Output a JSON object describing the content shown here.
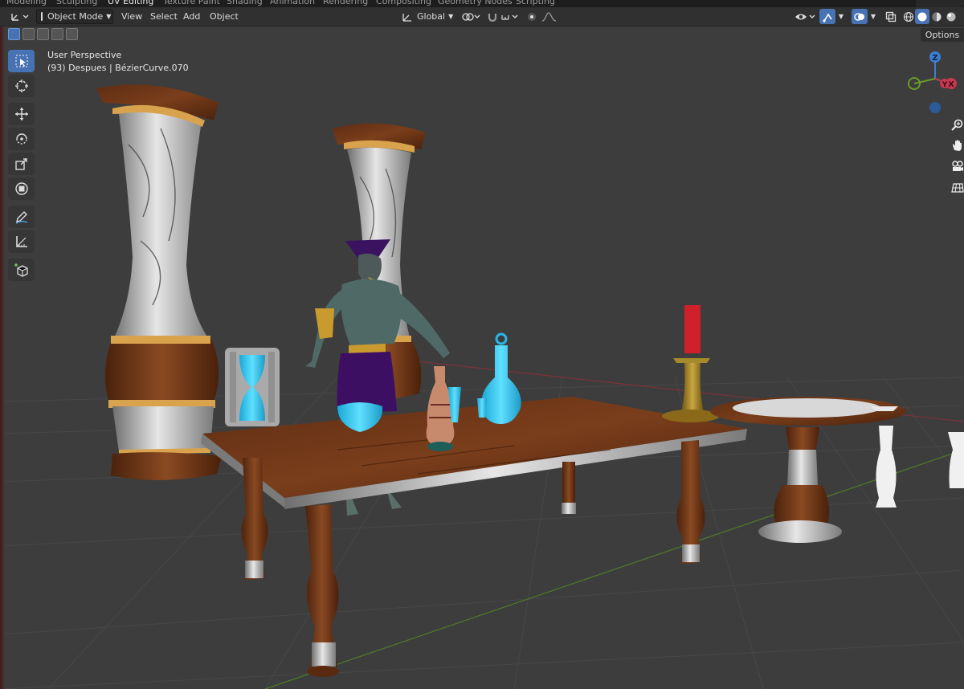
{
  "workspace_tabs": [
    {
      "label": "Modeling",
      "active": false
    },
    {
      "label": "Sculpting",
      "active": false
    },
    {
      "label": "UV Editing",
      "active": true
    },
    {
      "label": "Texture Paint",
      "active": false
    },
    {
      "label": "Shading",
      "active": false
    },
    {
      "label": "Animation",
      "active": false
    },
    {
      "label": "Rendering",
      "active": false
    },
    {
      "label": "Compositing",
      "active": false
    },
    {
      "label": "Geometry Nodes",
      "active": false
    },
    {
      "label": "Scripting",
      "active": false
    }
  ],
  "header": {
    "mode": "Object Mode",
    "menu": [
      "View",
      "Select",
      "Add",
      "Object"
    ],
    "transform_orientation": "Global"
  },
  "viewport": {
    "perspective": "User Perspective",
    "object_info": "(93) Despues | BézierCurve.070",
    "options_label": "Options"
  },
  "gizmo": {
    "z": "Z",
    "y": "Y",
    "x": "X"
  },
  "colors": {
    "accent": "#4772b3",
    "x_axis": "#c8384f",
    "y_axis": "#6a9c2a",
    "z_axis": "#3b7fd4"
  },
  "tools": [
    "select-box",
    "cursor",
    "move",
    "rotate",
    "scale",
    "transform",
    "annotate",
    "measure",
    "add-cube"
  ],
  "nav_icons": [
    "zoom",
    "pan",
    "camera",
    "grid"
  ]
}
